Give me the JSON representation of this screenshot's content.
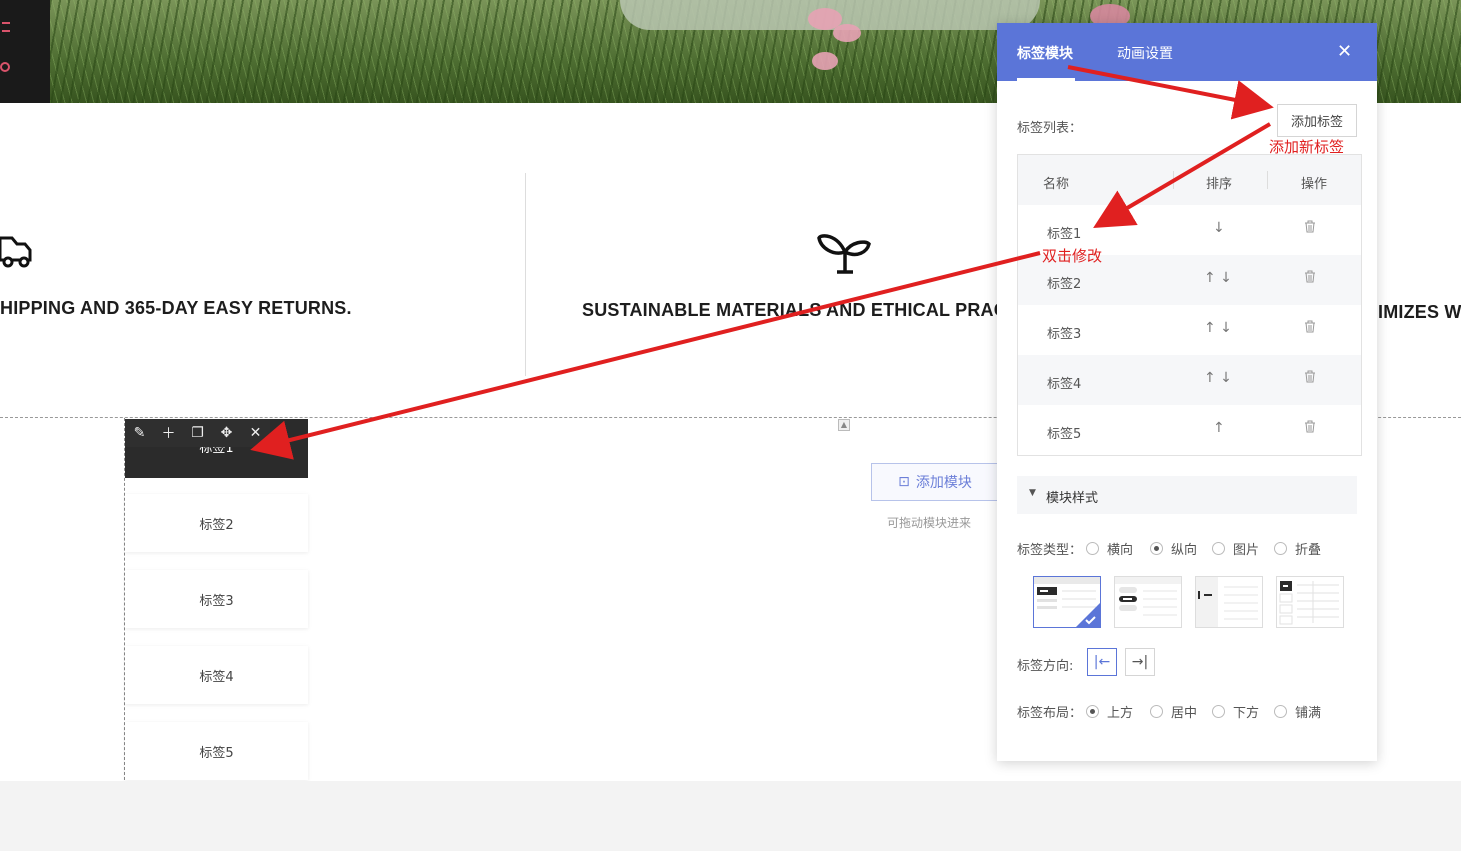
{
  "features": [
    {
      "text": "HIPPING AND 365-DAY EASY RETURNS.",
      "icon": "truck-icon"
    },
    {
      "text": "SUSTAINABLE MATERIALS AND ETHICAL PRAC",
      "icon": "sprout-icon"
    },
    {
      "text": "IMIZES W",
      "icon": ""
    }
  ],
  "canvas_tabs": [
    "标签1",
    "标签2",
    "标签3",
    "标签4",
    "标签5"
  ],
  "toolbar": [
    "edit-icon",
    "plus-icon",
    "copy-icon",
    "move-icon",
    "close-icon"
  ],
  "add_module": {
    "label": "添加模块",
    "hint": "可拖动模块进来"
  },
  "panel": {
    "tabs": [
      "标签模块",
      "动画设置"
    ],
    "list_label": "标签列表：",
    "add_tag_button": "添加标签",
    "table_headers": [
      "名称",
      "排序",
      "操作"
    ],
    "rows": [
      {
        "name": "标签1",
        "sort": "↓"
      },
      {
        "name": "标签2",
        "sort": "↑ ↓"
      },
      {
        "name": "标签3",
        "sort": "↑ ↓"
      },
      {
        "name": "标签4",
        "sort": "↑ ↓"
      },
      {
        "name": "标签5",
        "sort": "↑"
      }
    ],
    "section_title": "模块样式",
    "type_label": "标签类型：",
    "type_options": [
      "横向",
      "纵向",
      "图片",
      "折叠"
    ],
    "type_selected": "纵向",
    "direction_label": "标签方向:",
    "layout_label": "标签布局：",
    "layout_options": [
      "上方",
      "居中",
      "下方",
      "铺满"
    ],
    "layout_selected": "上方"
  },
  "annotations": {
    "add_new": "添加新标签",
    "double_click": "双击修改"
  },
  "colors": {
    "accent": "#5b75d8",
    "annotation": "#e02020"
  }
}
